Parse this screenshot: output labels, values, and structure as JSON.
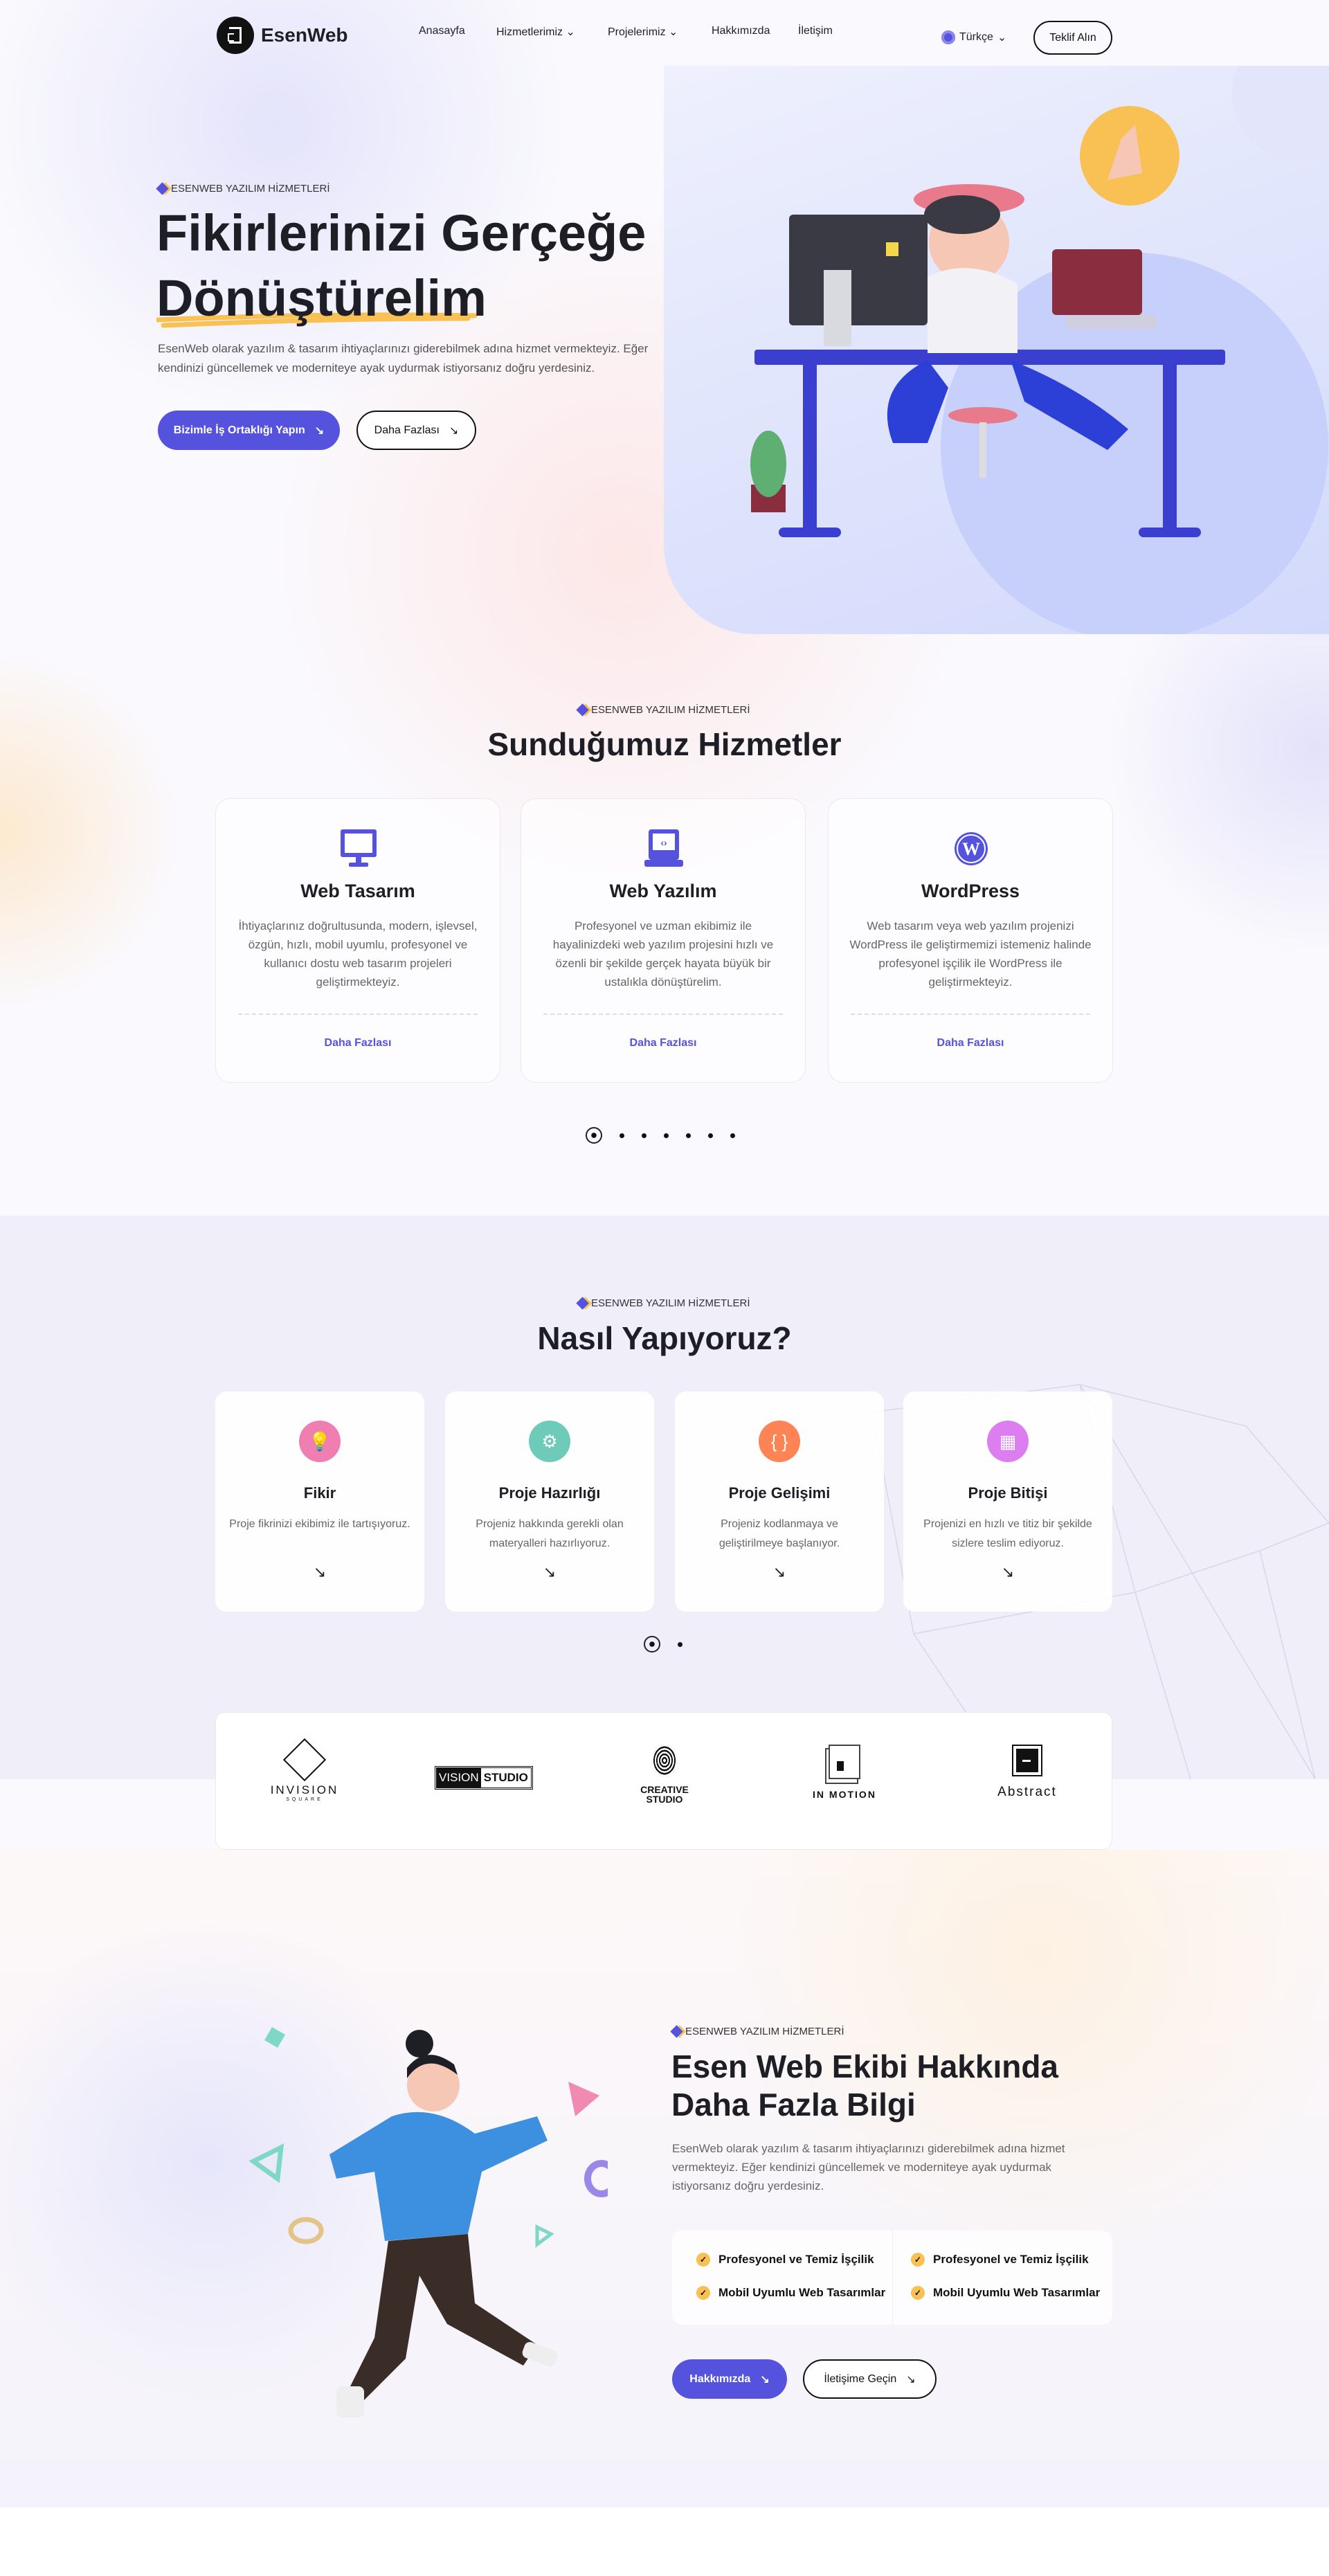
{
  "header": {
    "brand": "EsenWeb",
    "nav": [
      {
        "label": "Anasayfa"
      },
      {
        "label": "Hizmetlerimiz",
        "dropdown": true
      },
      {
        "label": "Projelerimiz",
        "dropdown": true
      },
      {
        "label": "Hakkımızda"
      },
      {
        "label": "İletişim"
      }
    ],
    "language": "Türkçe",
    "cta": "Teklif Alın"
  },
  "hero": {
    "tag": "ESENWEB YAZILIM HİZMETLERİ",
    "title_line1": "Fikirlerinizi Gerçeğe",
    "title_line2": "Dönüştürelim",
    "description": "EsenWeb olarak yazılım & tasarım ihtiyaçlarınızı giderebilmek adına hizmet vermekteyiz. Eğer kendinizi güncellemek ve moderniteye ayak uydurmak istiyorsanız doğru yerdesiniz.",
    "primary_button": "Bizimle İş Ortaklığı Yapın",
    "secondary_button": "Daha Fazlası"
  },
  "services": {
    "tag": "ESENWEB YAZILIM HİZMETLERİ",
    "title": "Sunduğumuz Hizmetler",
    "cards": [
      {
        "icon": "monitor-icon",
        "title": "Web Tasarım",
        "description": "İhtiyaçlarınız doğrultusunda, modern, işlevsel, özgün, hızlı, mobil uyumlu, profesyonel ve kullanıcı dostu web tasarım projeleri geliştirmekteyiz.",
        "link": "Daha Fazlası"
      },
      {
        "icon": "code-laptop-icon",
        "title": "Web Yazılım",
        "description": "Profesyonel ve uzman ekibimiz ile hayalinizdeki web yazılım projesini hızlı ve özenli bir şekilde gerçek hayata büyük bir ustalıkla dönüştürelim.",
        "link": "Daha Fazlası"
      },
      {
        "icon": "wordpress-icon",
        "title": "WordPress",
        "description": "Web tasarım veya web yazılım projenizi WordPress ile geliştirmemizi istemeniz halinde profesyonel işçilik ile WordPress ile geliştirmekteyiz.",
        "link": "Daha Fazlası"
      }
    ],
    "pagination": {
      "pages": 7,
      "active": 1
    }
  },
  "process": {
    "tag": "ESENWEB YAZILIM HİZMETLERİ",
    "title": "Nasıl Yapıyoruz?",
    "steps": [
      {
        "icon": "lightbulb-icon",
        "color": "#ee7fb0",
        "title": "Fikir",
        "description": "Proje fikrinizi ekibimiz ile tartışıyoruz."
      },
      {
        "icon": "gear-icon",
        "color": "#6fcbb9",
        "title": "Proje Hazırlığı",
        "description": "Projeniz hakkında gerekli olan materyalleri hazırlıyoruz."
      },
      {
        "icon": "braces-icon",
        "color": "#ff8455",
        "title": "Proje Gelişimi",
        "description": "Projeniz kodlanmaya ve geliştirilmeye başlanıyor."
      },
      {
        "icon": "grid-icon",
        "color": "#dd7ef0",
        "title": "Proje Bitişi",
        "description": "Projenizi en hızlı ve titiz bir şekilde sizlere teslim ediyoruz."
      }
    ],
    "pagination": {
      "pages": 2,
      "active": 1
    }
  },
  "partners": [
    {
      "name": "INVISION",
      "sub": "SQUARE"
    },
    {
      "name": "VISION",
      "sub": "STUDIO"
    },
    {
      "name": "CREATIVE",
      "sub": "STUDIO"
    },
    {
      "name": "IN MOTION"
    },
    {
      "name": "Abstract"
    }
  ],
  "about": {
    "tag": "ESENWEB YAZILIM HİZMETLERİ",
    "title_line1": "Esen Web Ekibi Hakkında",
    "title_line2": "Daha Fazla Bilgi",
    "description": "EsenWeb olarak yazılım & tasarım ihtiyaçlarınızı giderebilmek adına hizmet vermekteyiz. Eğer kendinizi güncellemek ve moderniteye ayak uydurmak istiyorsanız doğru yerdesiniz.",
    "features": [
      "Profesyonel ve Temiz İşçilik",
      "Mobil Uyumlu Web Tasarımlar",
      "Profesyonel ve Temiz İşçilik",
      "Mobil Uyumlu Web Tasarımlar"
    ],
    "primary_button": "Hakkımızda",
    "secondary_button": "İletişime Geçin"
  },
  "colors": {
    "accent": "#5553dd",
    "highlight": "#f9c053",
    "text": "#1e1f26"
  }
}
